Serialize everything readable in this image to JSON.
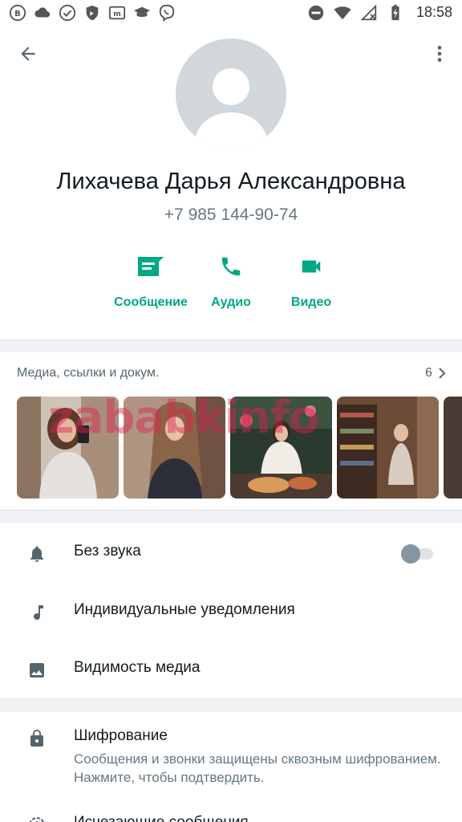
{
  "status_bar": {
    "time": "18:58",
    "left_icons": [
      "vk-icon",
      "cloud-icon",
      "check-circle-icon",
      "shield-icon",
      "m-box-icon",
      "graduation-cap-icon",
      "viber-icon"
    ],
    "right_icons": [
      "do-not-disturb-icon",
      "wifi-icon",
      "no-signal-icon",
      "battery-charging-icon"
    ]
  },
  "contact": {
    "name": "Лихачева Дарья Александровна",
    "phone": "+7 985 144-90-74"
  },
  "actions": {
    "message": "Сообщение",
    "audio": "Аудио",
    "video": "Видео"
  },
  "media": {
    "title": "Медиа, ссылки и докум.",
    "count": "6",
    "watermark": "zababkinfo"
  },
  "settings": {
    "mute": "Без звука",
    "mute_enabled": false,
    "custom_notifications": "Индивидуальные уведомления",
    "media_visibility": "Видимость медиа",
    "encryption_title": "Шифрование",
    "encryption_sub": "Сообщения и звонки защищены сквозным шифрованием. Нажмите, чтобы подтвердить.",
    "disappearing": "Исчезающие сообщения"
  },
  "colors": {
    "accent": "#00a884",
    "icon_gray": "#54656f",
    "text_primary": "#111b21",
    "text_secondary": "#667781"
  }
}
